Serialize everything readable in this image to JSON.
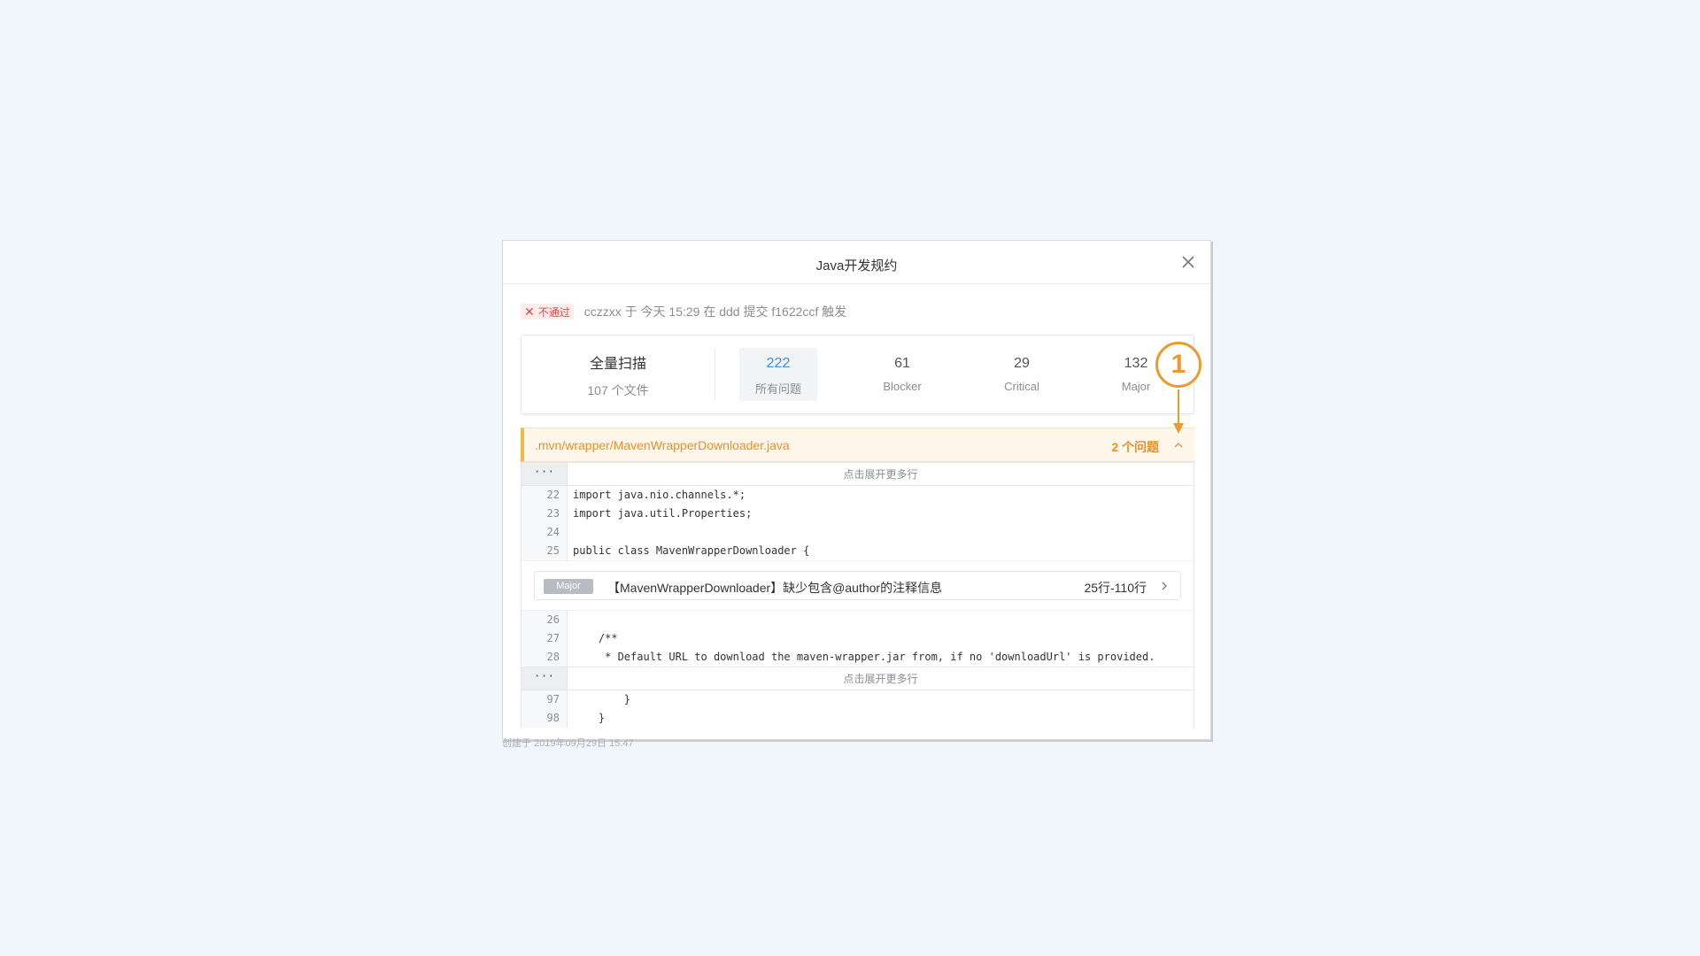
{
  "modal": {
    "title": "Java开发规约"
  },
  "status": {
    "badge": "不通过",
    "text": "cczzxx 于 今天 15:29 在 ddd 提交 f1622ccf 触发"
  },
  "summary": {
    "scan_title": "全量扫描",
    "scan_sub": "107 个文件",
    "stats": [
      {
        "value": "222",
        "label": "所有问题"
      },
      {
        "value": "61",
        "label": "Blocker"
      },
      {
        "value": "29",
        "label": "Critical"
      },
      {
        "value": "132",
        "label": "Major"
      }
    ]
  },
  "file": {
    "path": ".mvn/wrapper/MavenWrapperDownloader.java",
    "issue_count": "2 个问题"
  },
  "code": {
    "expand_label": "点击展开更多行",
    "ellipsis": "···",
    "block1": [
      {
        "ln": "22",
        "text": "import java.nio.channels.*;"
      },
      {
        "ln": "23",
        "text": "import java.util.Properties;"
      },
      {
        "ln": "24",
        "text": ""
      },
      {
        "ln": "25",
        "text": "public class MavenWrapperDownloader {"
      }
    ],
    "block2": [
      {
        "ln": "26",
        "text": ""
      },
      {
        "ln": "27",
        "text": "    /**"
      },
      {
        "ln": "28",
        "text": "     * Default URL to download the maven-wrapper.jar from, if no 'downloadUrl' is provided."
      }
    ],
    "block3": [
      {
        "ln": "97",
        "text": "        }"
      },
      {
        "ln": "98",
        "text": "    }"
      }
    ]
  },
  "issue": {
    "severity": "Major",
    "message": "【MavenWrapperDownloader】缺少包含@author的注释信息",
    "range": "25行-110行"
  },
  "annotation": {
    "number": "1"
  },
  "footer_fragment": "创建于 2019年09月29日 15:47"
}
